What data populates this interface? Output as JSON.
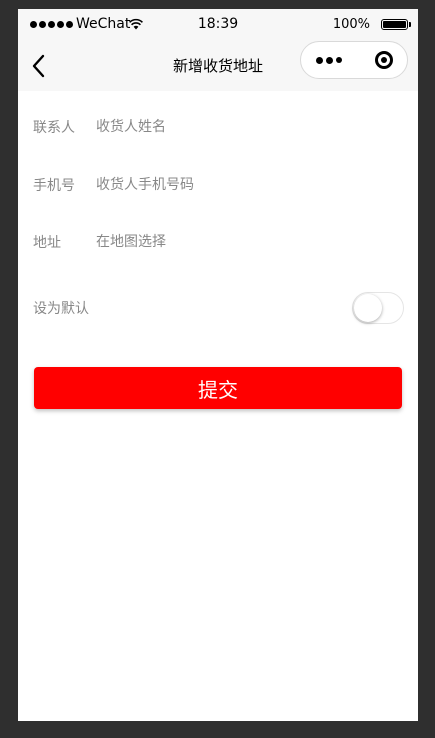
{
  "status_bar": {
    "carrier": "WeChat",
    "time": "18:39",
    "battery_percent": "100%",
    "battery_level": 1.0,
    "signal_icon": "signal-dots-icon",
    "wifi_icon": "wifi-icon",
    "battery_icon": "battery-icon"
  },
  "nav": {
    "title": "新增收货地址",
    "back_icon": "chevron-left-icon",
    "more_icon": "more-dots-icon",
    "close_icon": "target-close-icon"
  },
  "form": {
    "fields": [
      {
        "label": "联系人",
        "placeholder": "收货人姓名",
        "value": ""
      },
      {
        "label": "手机号",
        "placeholder": "收货人手机号码",
        "value": ""
      },
      {
        "label": "地址",
        "placeholder": "在地图选择",
        "value": ""
      }
    ],
    "default_label": "设为默认",
    "default_on": false
  },
  "submit": {
    "label": "提交"
  },
  "colors": {
    "accent": "#ff0000",
    "label_gray": "#888888",
    "bar_bg": "#f7f7f7",
    "frame_bg": "#2f2f2f"
  }
}
